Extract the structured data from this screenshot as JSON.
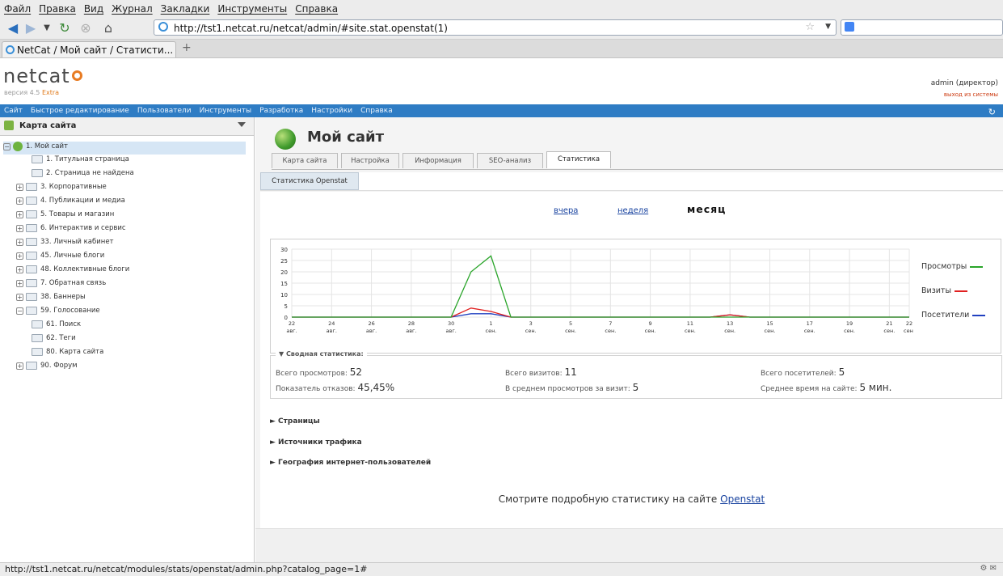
{
  "browser": {
    "menu": [
      "Файл",
      "Правка",
      "Вид",
      "Журнал",
      "Закладки",
      "Инструменты",
      "Справка"
    ],
    "url": "http://tst1.netcat.ru/netcat/admin/#site.stat.openstat(1)",
    "tab_title": "NetCat / Мой сайт / Статисти...",
    "new_tab_icon": "+",
    "status_text": "http://tst1.netcat.ru/netcat/modules/stats/openstat/admin.php?catalog_page=1#"
  },
  "header": {
    "logo": "netcat",
    "version_prefix": "версия 4.5",
    "version_edition": "Extra",
    "user": "admin (директор)",
    "logout": "выход из системы"
  },
  "main_nav": [
    "Сайт",
    "Быстрое редактирование",
    "Пользователи",
    "Инструменты",
    "Разработка",
    "Настройки",
    "Справка"
  ],
  "sidebar": {
    "title": "Карта сайта",
    "items": [
      {
        "label": "1. Мой сайт",
        "level": 0,
        "expander": "−",
        "selected": true,
        "icon": "globe-icon"
      },
      {
        "label": "1. Титульная страница",
        "level": 2,
        "expander": "",
        "icon": "folder-icon"
      },
      {
        "label": "2. Страница не найдена",
        "level": 2,
        "expander": "",
        "icon": "folder-icon"
      },
      {
        "label": "3. Корпоративные",
        "level": 1,
        "expander": "+",
        "icon": "folder-icon"
      },
      {
        "label": "4. Публикации и медиа",
        "level": 1,
        "expander": "+",
        "icon": "folder-icon"
      },
      {
        "label": "5. Товары и магазин",
        "level": 1,
        "expander": "+",
        "icon": "folder-icon"
      },
      {
        "label": "6. Интерактив и сервис",
        "level": 1,
        "expander": "+",
        "icon": "folder-icon"
      },
      {
        "label": "33. Личный кабинет",
        "level": 1,
        "expander": "+",
        "icon": "folder-icon"
      },
      {
        "label": "45. Личные блоги",
        "level": 1,
        "expander": "+",
        "icon": "folder-icon"
      },
      {
        "label": "48. Коллективные блоги",
        "level": 1,
        "expander": "+",
        "icon": "folder-icon"
      },
      {
        "label": "7. Обратная связь",
        "level": 1,
        "expander": "+",
        "icon": "folder-icon"
      },
      {
        "label": "38. Баннеры",
        "level": 1,
        "expander": "+",
        "icon": "folder-icon"
      },
      {
        "label": "59. Голосование",
        "level": 1,
        "expander": "−",
        "icon": "folder-icon"
      },
      {
        "label": "61. Поиск",
        "level": 2,
        "expander": "",
        "icon": "folder-icon"
      },
      {
        "label": "62. Теги",
        "level": 2,
        "expander": "",
        "icon": "folder-icon"
      },
      {
        "label": "80. Карта сайта",
        "level": 2,
        "expander": "",
        "icon": "folder-icon"
      },
      {
        "label": "90. Форум",
        "level": 1,
        "expander": "+",
        "icon": "folder-icon"
      }
    ]
  },
  "page": {
    "title": "Мой сайт",
    "tabs": [
      "Карта сайта",
      "Настройка",
      "Информация",
      "SEO-анализ",
      "Статистика"
    ],
    "active_tab": 4,
    "subtab": "Статистика Openstat",
    "periods": {
      "yesterday": "вчера",
      "week": "неделя",
      "month": "месяц"
    }
  },
  "chart_data": {
    "type": "line",
    "categories": [
      "22 авг.",
      "24 авг.",
      "26 авг.",
      "28 авг.",
      "30 авг.",
      "1 сен.",
      "3 сен.",
      "5 сен.",
      "7 сен.",
      "9 сен.",
      "11 сен.",
      "13 сен.",
      "15 сен.",
      "17 сен.",
      "19 сен.",
      "21 сен.",
      "22 сен."
    ],
    "x_days": [
      "22",
      "23",
      "24",
      "25",
      "26",
      "27",
      "28",
      "29",
      "30",
      "31",
      "1",
      "2",
      "3",
      "4",
      "5",
      "6",
      "7",
      "8",
      "9",
      "10",
      "11",
      "12",
      "13",
      "14",
      "15",
      "16",
      "17",
      "18",
      "19",
      "20",
      "21",
      "22"
    ],
    "ylim": [
      0,
      30
    ],
    "yticks": [
      0,
      5,
      10,
      15,
      20,
      25,
      30
    ],
    "series": [
      {
        "name": "Просмотры",
        "color": "#2aa52a",
        "values": [
          0,
          0,
          0,
          0,
          0,
          0,
          0,
          0,
          0,
          20,
          27,
          0,
          0,
          0,
          0,
          0,
          0,
          0,
          0,
          0,
          0,
          0,
          0,
          0,
          0,
          0,
          0,
          0,
          0,
          0,
          0,
          0
        ]
      },
      {
        "name": "Визиты",
        "color": "#e02020",
        "values": [
          0,
          0,
          0,
          0,
          0,
          0,
          0,
          0,
          0,
          4,
          2.5,
          0,
          0,
          0,
          0,
          0,
          0,
          0,
          0,
          0,
          0,
          0,
          1,
          0,
          0,
          0,
          0,
          0,
          0,
          0,
          0,
          0
        ]
      },
      {
        "name": "Посетители",
        "color": "#2040c0",
        "values": [
          0,
          0,
          0,
          0,
          0,
          0,
          0,
          0,
          0,
          1.5,
          1.5,
          0,
          0,
          0,
          0,
          0,
          0,
          0,
          0,
          0,
          0,
          0,
          1,
          0,
          0,
          0,
          0,
          0,
          0,
          0,
          0,
          0
        ]
      }
    ],
    "legend": "right"
  },
  "summary": {
    "title": "▼ Сводная статистика:",
    "views_label": "Всего просмотров:",
    "views": "52",
    "visits_label": "Всего визитов:",
    "visits": "11",
    "visitors_label": "Всего посетителей:",
    "visitors": "5",
    "bounce_label": "Показатель отказов:",
    "bounce": "45,45%",
    "avg_views_label": "В среднем просмотров за визит:",
    "avg_views": "5",
    "avg_time_label": "Среднее время на сайте:",
    "avg_time": "5 мин."
  },
  "sections": [
    "► Страницы",
    "► Источники трафика",
    "► География интернет-пользователей"
  ],
  "openstat": {
    "text": "Смотрите подробную статистику на сайте",
    "link": "Openstat"
  }
}
